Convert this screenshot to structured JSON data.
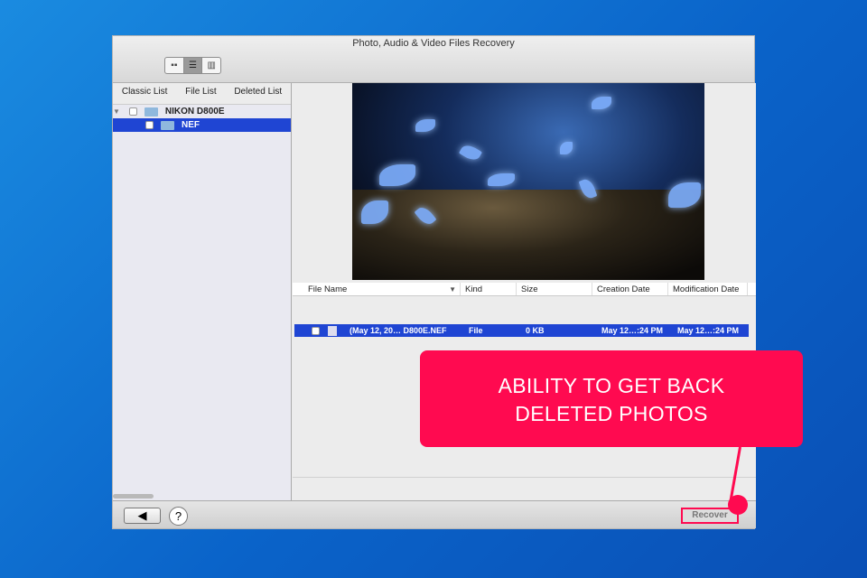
{
  "window": {
    "title": "Photo, Audio & Video Files Recovery"
  },
  "view_modes": [
    {
      "icon": "grid-icon"
    },
    {
      "icon": "list-icon"
    },
    {
      "icon": "filmstrip-icon"
    }
  ],
  "left_tabs": [
    "Classic List",
    "File List",
    "Deleted List"
  ],
  "tree": [
    {
      "label": "NIKON D800E",
      "expanded": true
    },
    {
      "label": "NEF",
      "selected": true
    }
  ],
  "table": {
    "columns": [
      "File Name",
      "Kind",
      "Size",
      "Creation Date",
      "Modification Date"
    ],
    "rows": [
      {
        "name": "(May 12, 20… D800E.NEF",
        "kind": "File",
        "size": "0 KB",
        "created": "May 12…:24 PM",
        "modified": "May 12…:24 PM"
      }
    ]
  },
  "bottom": {
    "back_icon": "arrow-left-icon",
    "help": "?",
    "recover": "Recover"
  },
  "callout": {
    "line1": "ABILITY TO GET BACK",
    "line2": "DELETED PHOTOS"
  },
  "colors": {
    "accent": "#ff0a50",
    "selection": "#1f45d3"
  }
}
